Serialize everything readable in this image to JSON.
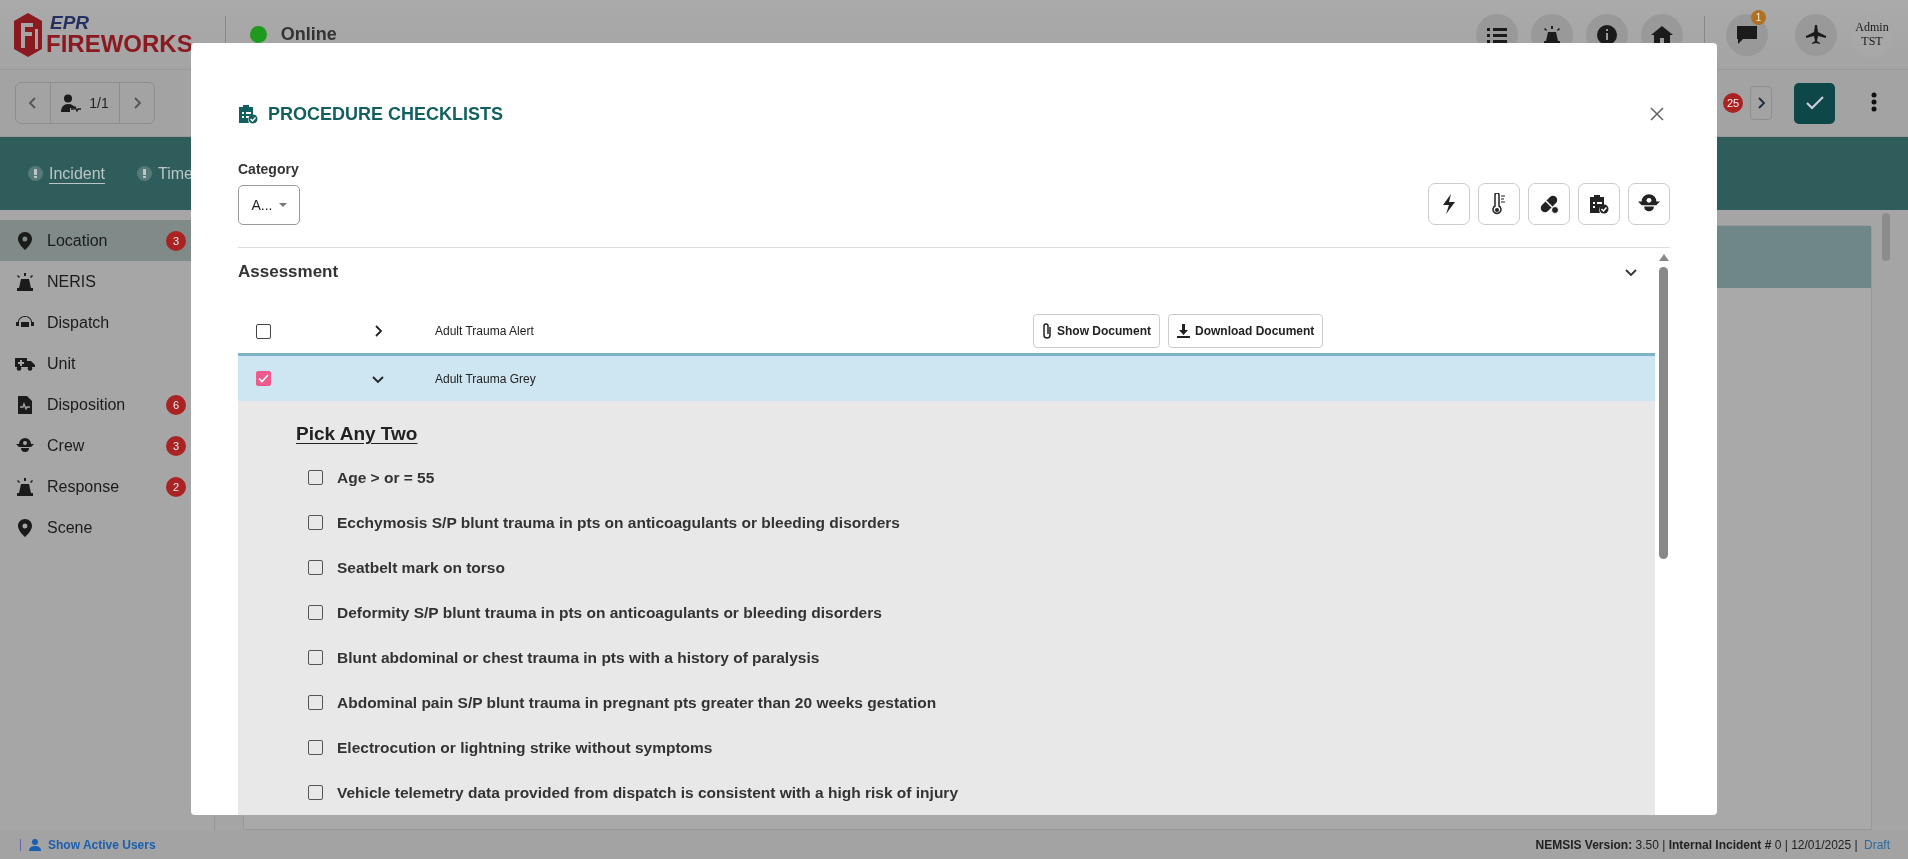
{
  "header": {
    "logo_top": "EPR",
    "logo_bottom": "FIREWORKS",
    "status": "Online",
    "notification_count": "1",
    "user_line1": "Admin",
    "user_line2": "TST"
  },
  "record_nav": {
    "counter": "1/1",
    "alert_count": "25"
  },
  "tabs": [
    {
      "label": "Incident",
      "selected": true
    },
    {
      "label": "Time",
      "selected": false
    }
  ],
  "sidebar": {
    "items": [
      {
        "label": "Location",
        "badge": "3",
        "selected": true
      },
      {
        "label": "NERIS",
        "selected": false
      },
      {
        "label": "Dispatch",
        "selected": false
      },
      {
        "label": "Unit",
        "selected": false
      },
      {
        "label": "Disposition",
        "badge": "6",
        "selected": false
      },
      {
        "label": "Crew",
        "badge": "3",
        "selected": false
      },
      {
        "label": "Response",
        "badge": "2",
        "selected": false
      },
      {
        "label": "Scene",
        "selected": false
      }
    ]
  },
  "modal": {
    "title": "PROCEDURE CHECKLISTS",
    "category_label": "Category",
    "category_value": "A...",
    "section": {
      "title": "Assessment",
      "expanded": true
    },
    "checklists": [
      {
        "name": "Adult Trauma Alert",
        "checked": false,
        "expanded": false,
        "actions": [
          "Show Document",
          "Download Document"
        ]
      },
      {
        "name": "Adult Trauma Grey",
        "checked": true,
        "expanded": true,
        "heading": "Pick Any Two",
        "items": [
          {
            "label": "Age > or = 55",
            "checked": false
          },
          {
            "label": "Ecchymosis S/P blunt trauma in pts on anticoagulants or bleeding disorders",
            "checked": false
          },
          {
            "label": "Seatbelt mark on torso",
            "checked": false
          },
          {
            "label": "Deformity S/P blunt trauma in pts on anticoagulants or bleeding disorders",
            "checked": false
          },
          {
            "label": "Blunt abdominal or chest trauma in pts with a history of paralysis",
            "checked": false
          },
          {
            "label": "Abdominal pain S/P blunt trauma in pregnant pts greater than 20 weeks gestation",
            "checked": false
          },
          {
            "label": "Electrocution or lightning strike without symptoms",
            "checked": false
          },
          {
            "label": "Vehicle telemetry data provided from dispatch is consistent with a high risk of injury",
            "checked": false
          }
        ]
      }
    ]
  },
  "footer": {
    "link": "Show Active Users",
    "status": "**NEMSIS Version:** 3.50 | **Internal Incident #** 0 | 12/01/2025 | ",
    "draft": "Draft"
  }
}
